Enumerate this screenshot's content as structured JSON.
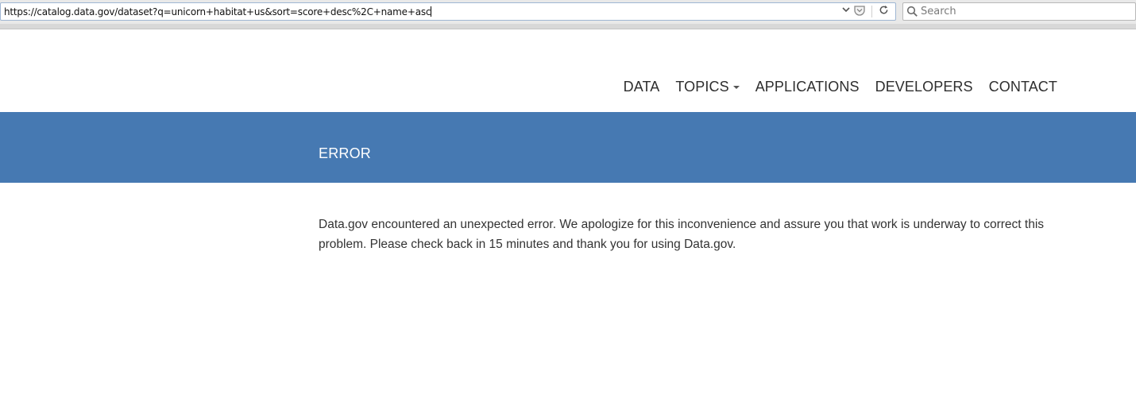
{
  "browser": {
    "url": "https://catalog.data.gov/dataset?q=unicorn+habitat+us&sort=score+desc%2C+name+asc",
    "search_placeholder": "Search",
    "icons": {
      "dropdown": "chevron-down-icon",
      "pocket": "pocket-icon",
      "reload": "reload-icon",
      "search": "search-icon"
    }
  },
  "nav": {
    "items": [
      {
        "label": "DATA"
      },
      {
        "label": "TOPICS",
        "has_dropdown": true
      },
      {
        "label": "APPLICATIONS"
      },
      {
        "label": "DEVELOPERS"
      },
      {
        "label": "CONTACT"
      }
    ]
  },
  "banner": {
    "title": "ERROR",
    "color": "#4679b2"
  },
  "message": {
    "text": "Data.gov encountered an unexpected error. We apologize for this inconvenience and assure you that work is underway to correct this problem. Please check back in 15 minutes and thank you for using Data.gov."
  }
}
